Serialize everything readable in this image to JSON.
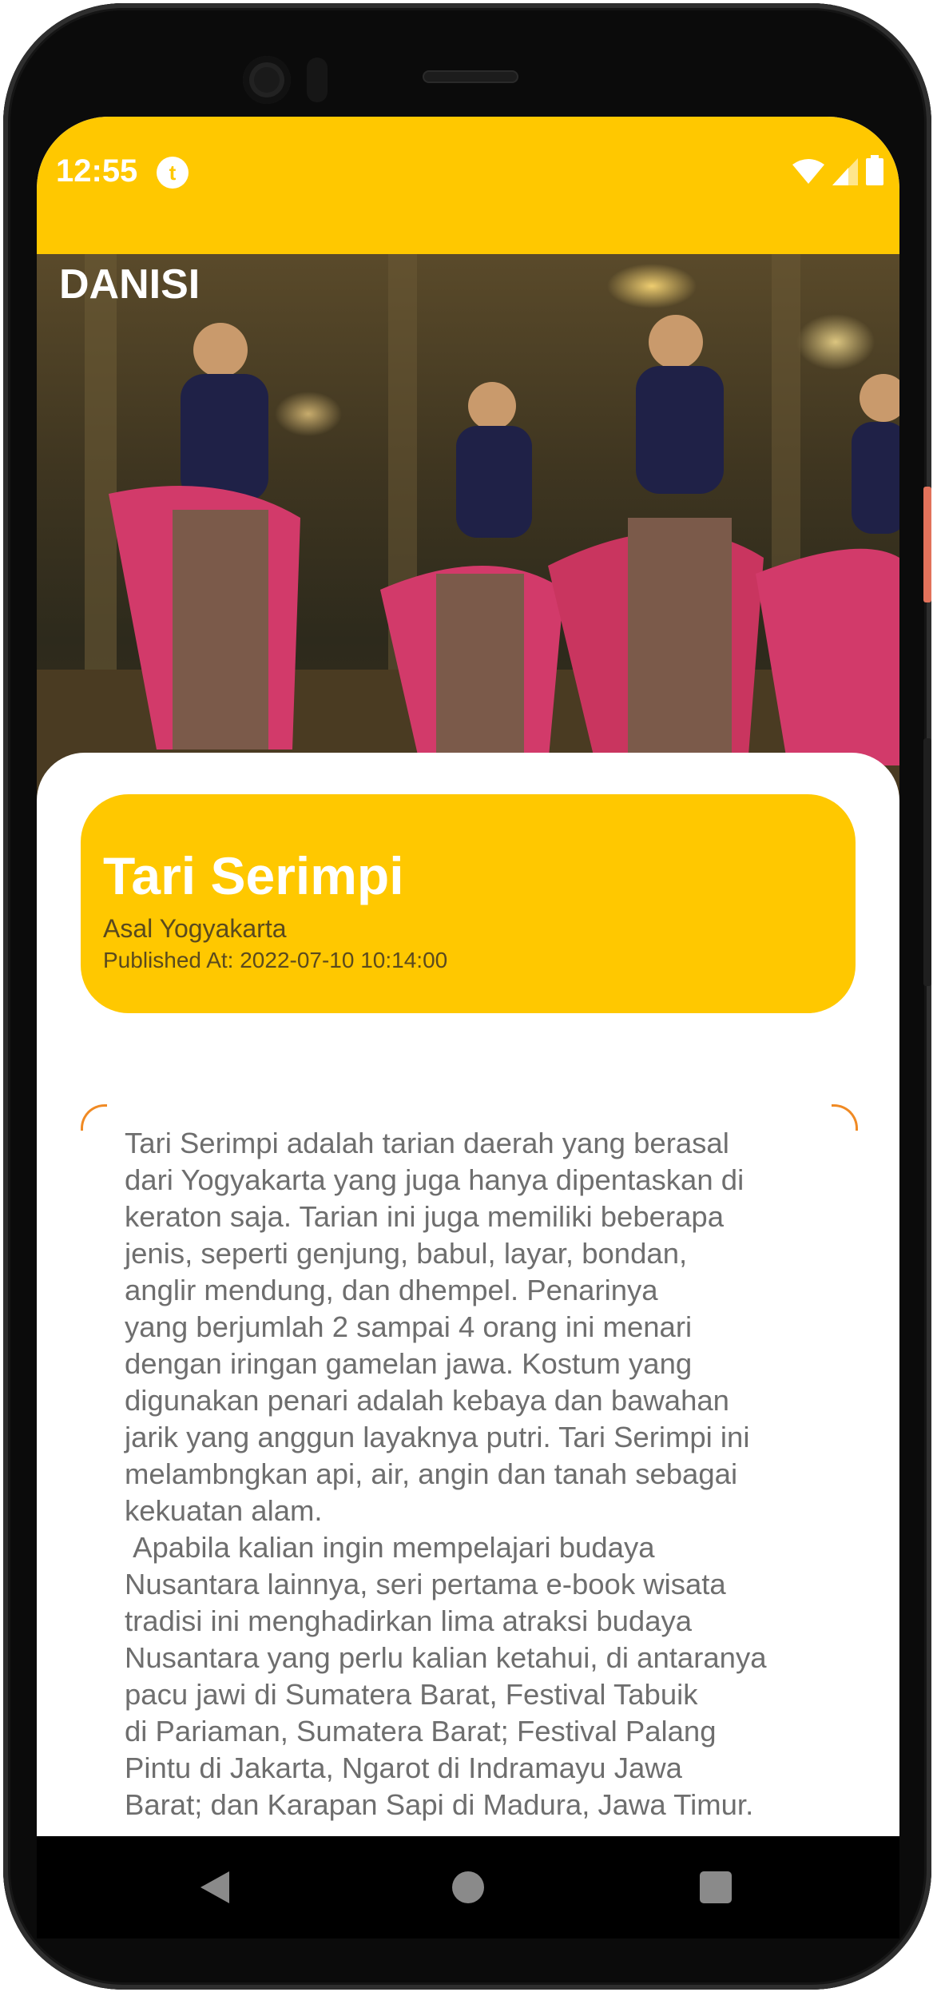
{
  "status_bar": {
    "time": "12:55",
    "app_icon_letter": "t"
  },
  "hero": {
    "title": "DANISI"
  },
  "card": {
    "title": "Tari Serimpi",
    "origin": "Asal Yogyakarta",
    "published": "Published At: 2022-07-10 10:14:00"
  },
  "description": "Tari Serimpi adalah tarian daerah yang berasal\ndari Yogyakarta yang juga hanya dipentaskan di\nkeraton saja. Tarian ini juga memiliki beberapa\njenis, seperti genjung, babul, layar, bondan,\nanglir mendung, dan dhempel. Penarinya\nyang berjumlah 2 sampai 4 orang ini menari\ndengan iringan gamelan jawa. Kostum yang\ndigunakan penari adalah kebaya dan bawahan\njarik yang anggun layaknya putri. Tari Serimpi ini\nmelambngkan api, air, angin dan tanah sebagai\nkekuatan alam.\n Apabila kalian ingin mempelajari budaya\nNusantara lainnya, seri pertama e-book wisata\ntradisi ini menghadirkan lima atraksi budaya\nNusantara yang perlu kalian ketahui, di antaranya\npacu jawi di Sumatera Barat, Festival Tabuik\ndi Pariaman, Sumatera Barat; Festival Palang\nPintu di Jakarta, Ngarot di Indramayu Jawa\nBarat; dan Karapan Sapi di Madura, Jawa Timur.",
  "colors": {
    "accent": "#ffc800",
    "text_muted": "#6e6e6e",
    "card_subtext": "#5a4a1e"
  },
  "icons": {
    "status": [
      "wifi-icon",
      "signal-icon",
      "battery-icon"
    ],
    "nav": [
      "back-icon",
      "home-icon",
      "recents-icon"
    ]
  }
}
